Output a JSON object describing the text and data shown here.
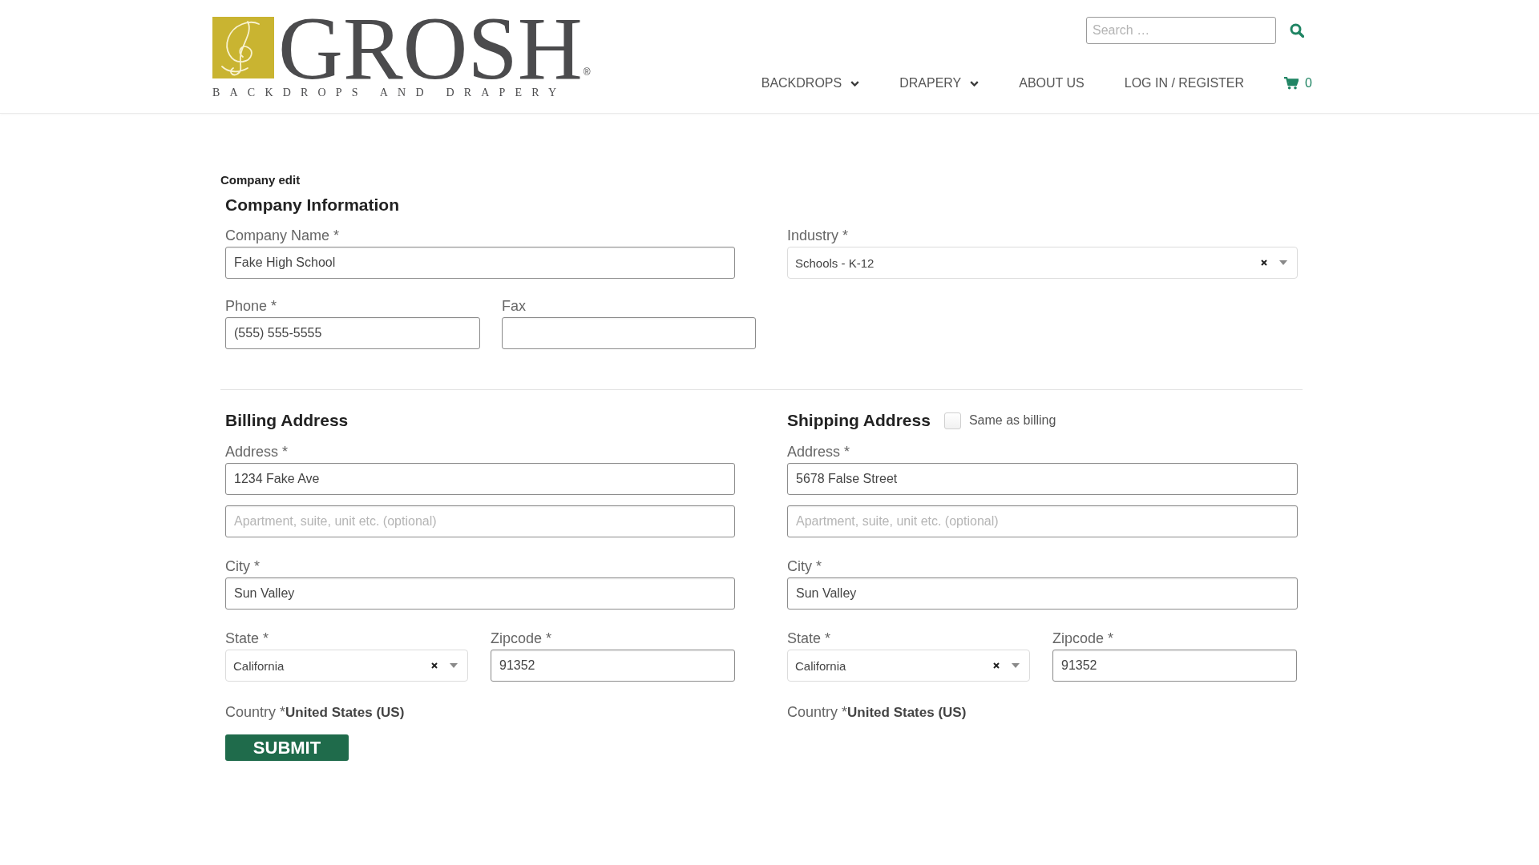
{
  "header": {
    "logo": {
      "wordmark": "GROSH",
      "registered": "®",
      "tagline": "BACKDROPS AND DRAPERY"
    },
    "search": {
      "placeholder": "Search …"
    },
    "nav": [
      {
        "label": "BACKDROPS",
        "dropdown": true
      },
      {
        "label": "DRAPERY",
        "dropdown": true
      },
      {
        "label": "ABOUT US",
        "dropdown": false
      },
      {
        "label": "LOG IN / REGISTER",
        "dropdown": false
      }
    ],
    "cart": {
      "count": "0"
    }
  },
  "page_title": "Company edit",
  "company": {
    "heading": "Company Information",
    "name": {
      "label": "Company Name *",
      "value": "Fake High School"
    },
    "industry": {
      "label": "Industry *",
      "value": "Schools - K-12"
    },
    "phone": {
      "label": "Phone *",
      "value": "(555) 555-5555"
    },
    "fax": {
      "label": "Fax"
    }
  },
  "billing": {
    "heading": "Billing Address",
    "address": {
      "label": "Address *",
      "value": "1234 Fake Ave"
    },
    "address_2": {
      "placeholder": "Apartment, suite, unit etc. (optional)"
    },
    "city": {
      "label": "City *",
      "value": "Sun Valley"
    },
    "state": {
      "label": "State *",
      "value": "California"
    },
    "zipcode": {
      "label": "Zipcode *",
      "value": "91352"
    },
    "country": {
      "label": "Country *",
      "value": "United States (US)"
    }
  },
  "shipping": {
    "heading": "Shipping Address",
    "same_as_billing": {
      "label": "Same as billing",
      "checked": false
    },
    "address": {
      "label": "Address *",
      "value": "5678 False Street"
    },
    "address_2": {
      "placeholder": "Apartment, suite, unit etc. (optional)"
    },
    "city": {
      "label": "City *",
      "value": "Sun Valley"
    },
    "state": {
      "label": "State *",
      "value": "California"
    },
    "zipcode": {
      "label": "Zipcode *",
      "value": "91352"
    },
    "country": {
      "label": "Country *",
      "value": "United States (US)"
    }
  },
  "submit": {
    "label": "SUBMIT"
  }
}
